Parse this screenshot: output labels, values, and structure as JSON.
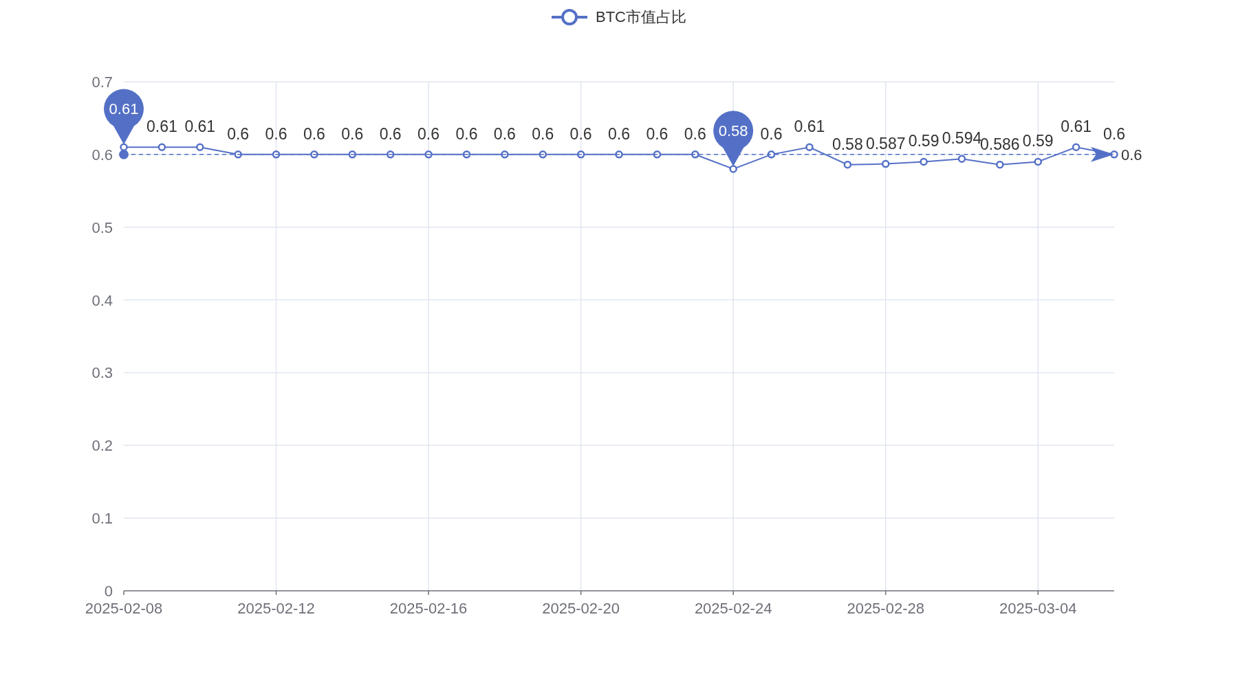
{
  "chart_data": {
    "type": "line",
    "categories": [
      "2025-02-08",
      null,
      null,
      null,
      "2025-02-12",
      null,
      null,
      null,
      "2025-02-16",
      null,
      null,
      null,
      "2025-02-20",
      null,
      null,
      null,
      "2025-02-24",
      null,
      null,
      null,
      "2025-02-28",
      null,
      null,
      null,
      "2025-03-04",
      null,
      null
    ],
    "series": [
      {
        "name": "BTC市值占比",
        "color": "#5470c6",
        "marker": "circle",
        "values": [
          0.61,
          0.61,
          0.61,
          0.6,
          0.6,
          0.6,
          0.6,
          0.6,
          0.6,
          0.6,
          0.6,
          0.6,
          0.6,
          0.6,
          0.6,
          0.6,
          0.58,
          0.6,
          0.61,
          0.586,
          0.587,
          0.59,
          0.594,
          0.586,
          0.59,
          0.61,
          0.6
        ]
      }
    ],
    "value_labels": [
      null,
      "0.61",
      "0.61",
      "0.6",
      "0.6",
      "0.6",
      "0.6",
      "0.6",
      "0.6",
      "0.6",
      "0.6",
      "0.6",
      "0.6",
      "0.6",
      "0.6",
      "0.6",
      null,
      "0.6",
      "0.61",
      "0.58",
      "0.587",
      "0.59",
      "0.594",
      "0.586",
      "0.59",
      "0.61",
      "0.6"
    ],
    "ylim": [
      0,
      0.7
    ],
    "yticks": [
      {
        "value": 0,
        "label": "0"
      },
      {
        "value": 0.1,
        "label": "0.1"
      },
      {
        "value": 0.2,
        "label": "0.2"
      },
      {
        "value": 0.3,
        "label": "0.3"
      },
      {
        "value": 0.4,
        "label": "0.4"
      },
      {
        "value": 0.5,
        "label": "0.5"
      },
      {
        "value": 0.6,
        "label": "0.6"
      },
      {
        "value": 0.7,
        "label": "0.7"
      }
    ],
    "grid": true,
    "annotations": [
      {
        "text": "0.61",
        "x": "2025-02-08",
        "y": 0.61
      },
      {
        "text": "0.58",
        "x": "2025-02-24",
        "y": 0.58
      }
    ],
    "ref_lines": [
      {
        "axis": "y",
        "value": 0.6,
        "label": "0.6",
        "color": "#5470c6"
      }
    ]
  }
}
